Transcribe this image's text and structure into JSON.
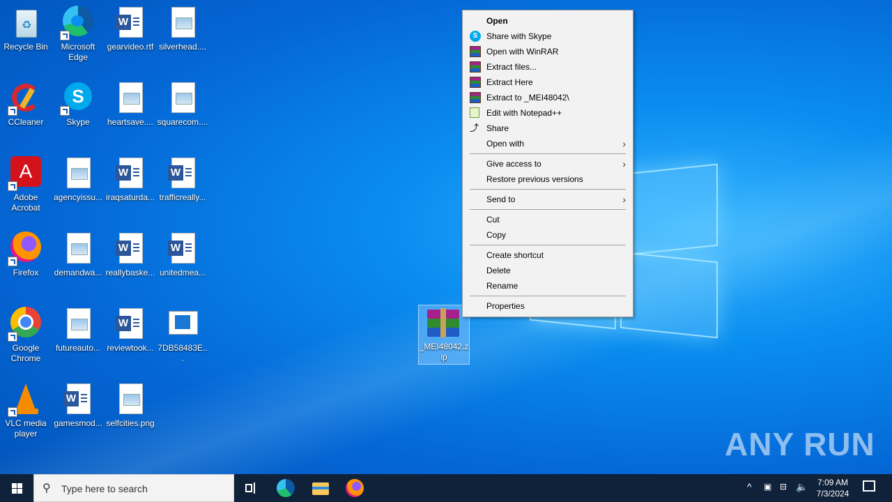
{
  "desktop": {
    "icons": [
      {
        "label": "Recycle Bin"
      },
      {
        "label": "Microsoft Edge"
      },
      {
        "label": "gearvideo.rtf"
      },
      {
        "label": "silverhead...."
      },
      {
        "label": "CCleaner"
      },
      {
        "label": "Skype"
      },
      {
        "label": "heartsave...."
      },
      {
        "label": "squarecom...."
      },
      {
        "label": "Adobe Acrobat"
      },
      {
        "label": "agencyissu..."
      },
      {
        "label": "iraqsaturda..."
      },
      {
        "label": "trafficreally..."
      },
      {
        "label": "Firefox"
      },
      {
        "label": "demandwa..."
      },
      {
        "label": "reallybaske..."
      },
      {
        "label": "unitedmea..."
      },
      {
        "label": "Google Chrome"
      },
      {
        "label": "futureauto..."
      },
      {
        "label": "reviewtook..."
      },
      {
        "label": "7DB58483E..."
      },
      {
        "label": "VLC media player"
      },
      {
        "label": "gamesmod..."
      },
      {
        "label": "selfcities.png"
      }
    ],
    "selected_file": {
      "label": "_MEI48042.zip"
    }
  },
  "context_menu": {
    "items": [
      {
        "label": "Open",
        "icon": "none"
      },
      {
        "label": "Share with Skype",
        "icon": "skype-icon"
      },
      {
        "label": "Open with WinRAR",
        "icon": "winrar-icon"
      },
      {
        "label": "Extract files...",
        "icon": "winrar-icon"
      },
      {
        "label": "Extract Here",
        "icon": "winrar-icon"
      },
      {
        "label": "Extract to _MEI48042\\",
        "icon": "winrar-icon"
      },
      {
        "label": "Edit with Notepad++",
        "icon": "notepad-plus-plus-icon"
      },
      {
        "label": "Share",
        "icon": "share-icon"
      },
      {
        "label": "Open with",
        "icon": "none"
      },
      {
        "label": "Give access to",
        "icon": "none"
      },
      {
        "label": "Restore previous versions",
        "icon": "none"
      },
      {
        "label": "Send to",
        "icon": "none"
      },
      {
        "label": "Cut",
        "icon": "none"
      },
      {
        "label": "Copy",
        "icon": "none"
      },
      {
        "label": "Create shortcut",
        "icon": "none"
      },
      {
        "label": "Delete",
        "icon": "none"
      },
      {
        "label": "Rename",
        "icon": "none"
      },
      {
        "label": "Properties",
        "icon": "none"
      }
    ]
  },
  "taskbar": {
    "search_placeholder": "Type here to search",
    "time": "7:09 AM",
    "date": "7/3/2024"
  },
  "watermark": "ANY RUN",
  "colors": {
    "taskbar": "#10213a",
    "menu_bg": "#f2f2f2",
    "accent": "#0a8ef0"
  }
}
